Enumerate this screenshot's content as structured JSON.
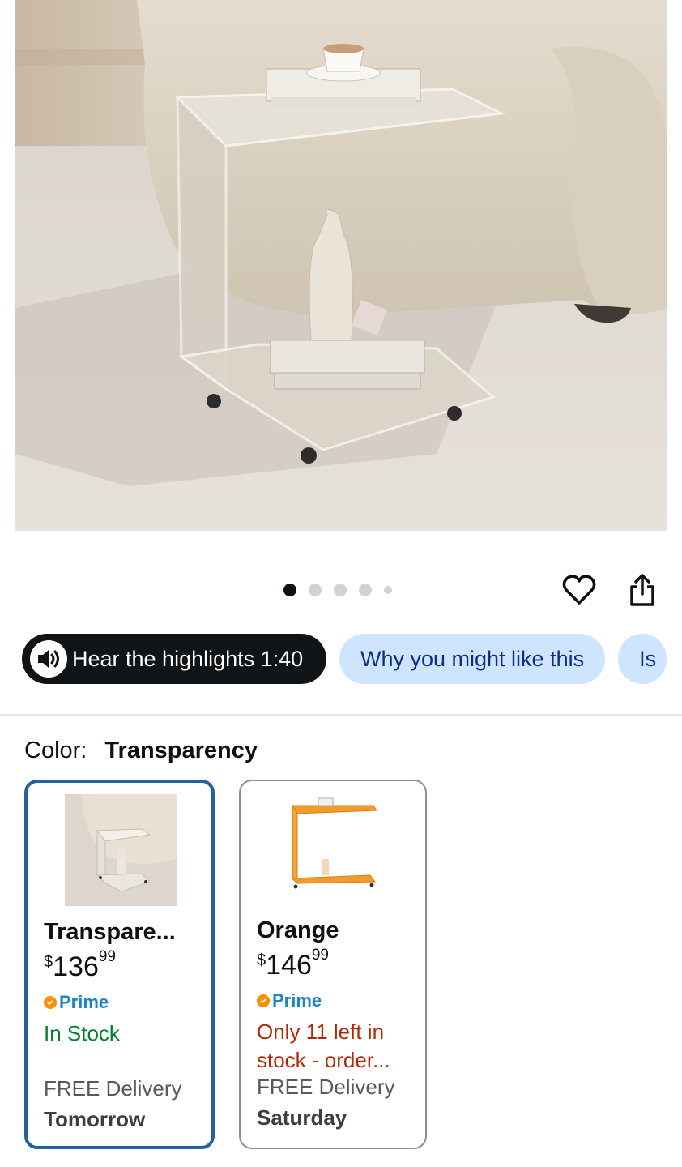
{
  "gallery": {
    "image_alt": "Clear acrylic C-shaped side table on wheels beside a cream sofa",
    "page_count": 5,
    "current_page": 1
  },
  "actions": {
    "wishlist_icon": "heart-icon",
    "share_icon": "share-icon"
  },
  "chips": [
    {
      "label": "Hear the highlights 1:40",
      "icon": "speaker-icon"
    },
    {
      "label": "Why you might like this"
    },
    {
      "label": "Is"
    }
  ],
  "color": {
    "label": "Color:",
    "selected": "Transparency"
  },
  "options": [
    {
      "name": "Transpare...",
      "price_currency": "$",
      "price_whole": "136",
      "price_fraction": "99",
      "prime": "Prime",
      "stock": "In Stock",
      "delivery": "FREE Delivery",
      "delivery_day": "Tomorrow",
      "selected": true
    },
    {
      "name": "Orange",
      "price_currency": "$",
      "price_whole": "146",
      "price_fraction": "99",
      "prime": "Prime",
      "stock": "Only 11 left in stock - order...",
      "delivery": "FREE Delivery",
      "delivery_day": "Saturday",
      "selected": false
    }
  ],
  "colors": {
    "selected_border": "#2162a1",
    "chip_blue": "#cfe5ff",
    "in_stock": "#067d2f",
    "low_stock": "#b12704",
    "prime_blue": "#1f84c6",
    "prime_check": "#ff8f00"
  }
}
